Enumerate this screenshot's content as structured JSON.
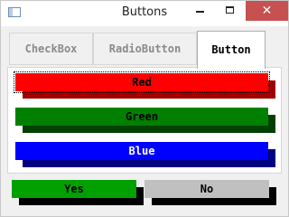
{
  "window": {
    "title": "Buttons",
    "controls": {
      "minimize": "",
      "maximize": "",
      "close": "✕"
    }
  },
  "tabs": [
    {
      "label": "CheckBox",
      "selected": false
    },
    {
      "label": "RadioButton",
      "selected": false
    },
    {
      "label": "Button",
      "selected": true
    }
  ],
  "color_buttons": [
    {
      "label": "Red",
      "face": "#ff0000",
      "shadow": "#a00000",
      "text_color": "#000000",
      "focused": true
    },
    {
      "label": "Green",
      "face": "#008000",
      "shadow": "#004000",
      "text_color": "#000000",
      "focused": false
    },
    {
      "label": "Blue",
      "face": "#0000ff",
      "shadow": "#000080",
      "text_color": "#ffffff",
      "focused": false
    }
  ],
  "dialog_buttons": [
    {
      "label": "Yes",
      "face": "#00a000"
    },
    {
      "label": "No",
      "face": "#c0c0c0"
    }
  ]
}
